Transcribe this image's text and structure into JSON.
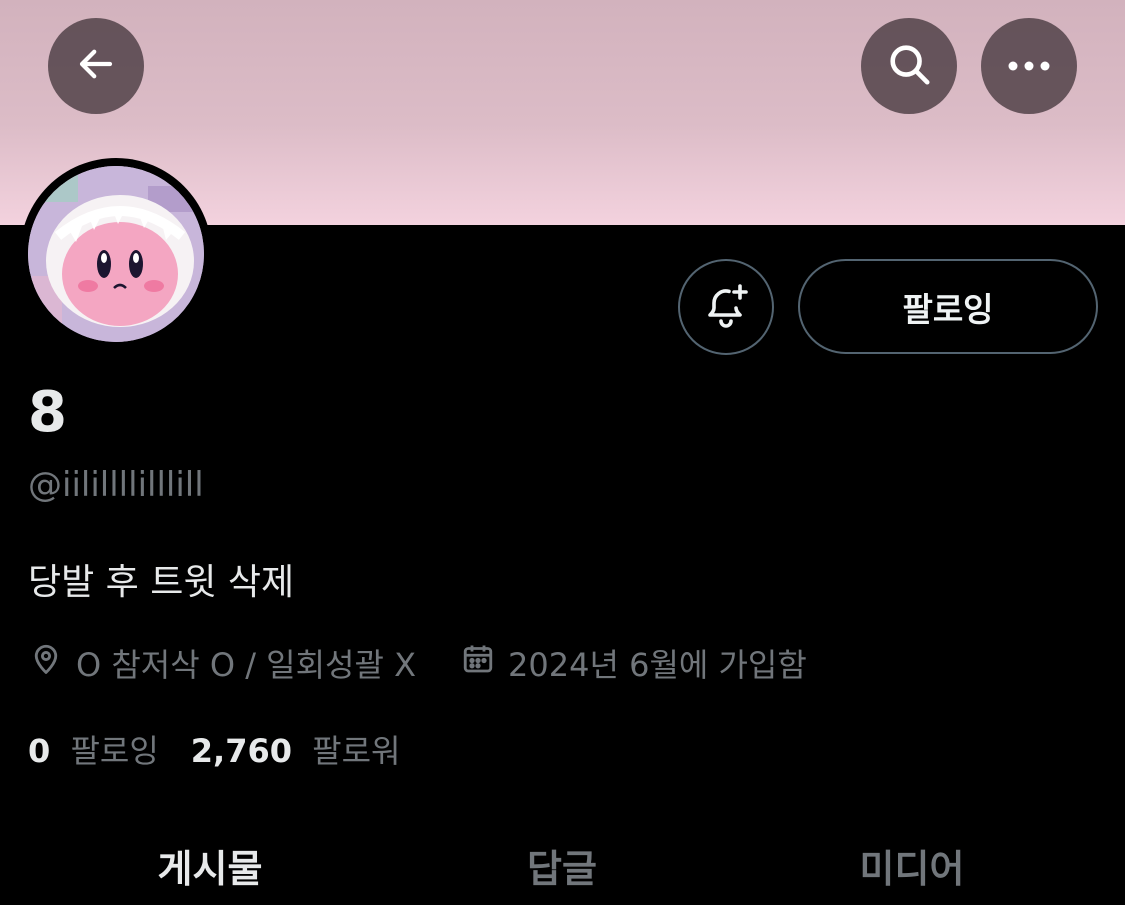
{
  "header": {
    "back_icon": "arrow-left-icon",
    "search_icon": "search-icon",
    "more_icon": "more-horizontal-icon",
    "banner_color_top": "#d2b2bd",
    "banner_color_bottom": "#f3d2de"
  },
  "profile": {
    "display_name": "8",
    "handle": "@iilillllilllill",
    "bio": "당발 후 트윗 삭제",
    "location": "O 참저삭 O / 일회성괄 X",
    "joined": "2024년 6월에 가입함",
    "location_icon": "location-pin-icon",
    "calendar_icon": "calendar-icon"
  },
  "actions": {
    "notify_icon": "bell-plus-icon",
    "follow_label": "팔로잉"
  },
  "stats": {
    "following_count": "0",
    "following_label": "팔로잉",
    "followers_count": "2,760",
    "followers_label": "팔로워"
  },
  "tabs": [
    {
      "label": "게시물",
      "active": true
    },
    {
      "label": "답글",
      "active": false
    },
    {
      "label": "미디어",
      "active": false
    }
  ],
  "colors": {
    "background": "#000000",
    "primary_text": "#e7e9ea",
    "secondary_text": "#71767b",
    "border": "#536471"
  }
}
